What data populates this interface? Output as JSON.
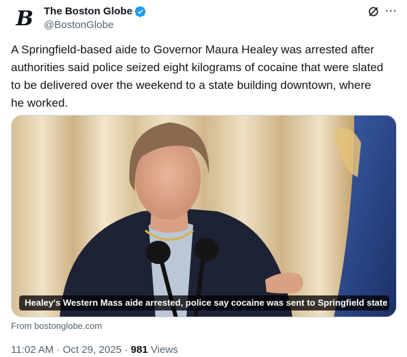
{
  "author": {
    "display_name": "The Boston Globe",
    "handle": "@BostonGlobe",
    "avatar_letter": "B",
    "verified": true,
    "verified_color": "#1d9bf0"
  },
  "header_icons": {
    "grok": "grok-icon",
    "more": "···"
  },
  "tweet": {
    "text": "A Springfield-based aide to Governor Maura Healey was arrested after\nauthorities said police seized eight kilograms of cocaine that were slated\nto be delivered over the weekend to a state building downtown, where\nhe worked."
  },
  "media_card": {
    "caption": "Healey's Western Mass aide arrested, police say cocaine was sent to Springfield state ...",
    "source": "From bostonglobe.com"
  },
  "meta": {
    "time": "11:02 AM",
    "separator": " · ",
    "date": "Oct 29, 2025",
    "views_count": "981",
    "views_label": " Views"
  },
  "colors": {
    "text": "#0f1419",
    "secondary": "#536471",
    "border": "#cfd9de"
  }
}
